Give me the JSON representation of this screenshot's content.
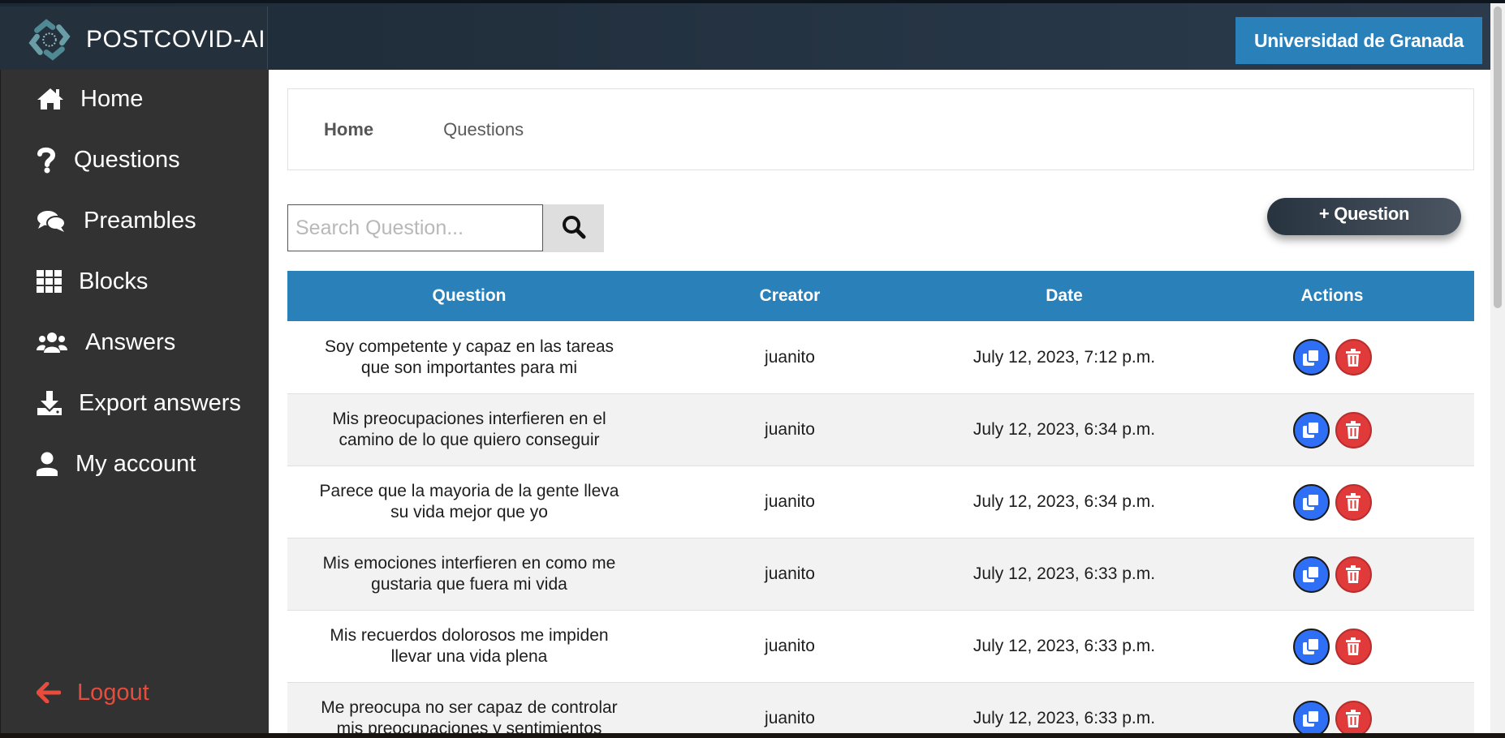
{
  "brand": {
    "name": "POSTCOVID-AI"
  },
  "header": {
    "university_label": "Universidad de Granada"
  },
  "sidebar": {
    "items": [
      {
        "label": "Home",
        "icon": "home-icon"
      },
      {
        "label": "Questions",
        "icon": "question-icon"
      },
      {
        "label": "Preambles",
        "icon": "comments-icon"
      },
      {
        "label": "Blocks",
        "icon": "grid-icon"
      },
      {
        "label": "Answers",
        "icon": "users-icon"
      },
      {
        "label": "Export answers",
        "icon": "download-icon"
      },
      {
        "label": "My account",
        "icon": "user-icon"
      }
    ],
    "logout_label": "Logout"
  },
  "breadcrumb": {
    "home": "Home",
    "current": "Questions"
  },
  "search": {
    "placeholder": "Search Question..."
  },
  "add_button": {
    "label": "+ Question"
  },
  "table": {
    "headers": [
      "Question",
      "Creator",
      "Date",
      "Actions"
    ],
    "rows": [
      {
        "question": "Soy competente y capaz en las tareas que son importantes para mi",
        "creator": "juanito",
        "date": "July 12, 2023, 7:12 p.m."
      },
      {
        "question": "Mis preocupaciones interfieren en el camino de lo que quiero conseguir",
        "creator": "juanito",
        "date": "July 12, 2023, 6:34 p.m."
      },
      {
        "question": "Parece que la mayoria de la gente lleva su vida mejor que yo",
        "creator": "juanito",
        "date": "July 12, 2023, 6:34 p.m."
      },
      {
        "question": "Mis emociones interfieren en como me gustaria que fuera mi vida",
        "creator": "juanito",
        "date": "July 12, 2023, 6:33 p.m."
      },
      {
        "question": "Mis recuerdos dolorosos me impiden llevar una vida plena",
        "creator": "juanito",
        "date": "July 12, 2023, 6:33 p.m."
      },
      {
        "question": "Me preocupa no ser capaz de controlar mis preocupaciones y sentimientos",
        "creator": "juanito",
        "date": "July 12, 2023, 6:33 p.m."
      }
    ]
  },
  "colors": {
    "header_blue": "#2a80b9",
    "sidebar_bg": "#323232",
    "logout_red": "#e74c3c",
    "copy_blue": "#2f6ff5",
    "delete_red": "#e13a3a"
  }
}
